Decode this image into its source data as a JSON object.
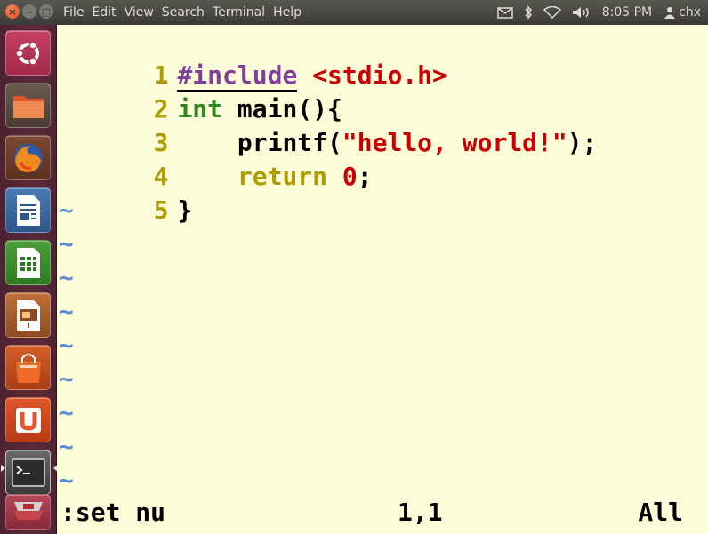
{
  "window": {
    "menu": [
      "File",
      "Edit",
      "View",
      "Search",
      "Terminal",
      "Help"
    ]
  },
  "panel": {
    "clock": "8:05 PM",
    "user": "chx",
    "indicators": [
      "mail-icon",
      "bluetooth-icon",
      "wifi-icon",
      "volume-icon"
    ]
  },
  "launcher": {
    "items": [
      "ubuntu-dash",
      "files",
      "firefox",
      "libreoffice-writer",
      "libreoffice-calc",
      "libreoffice-impress",
      "ubuntu-software-center",
      "ubuntu-one",
      "terminal",
      "trash-stack"
    ]
  },
  "editor": {
    "line_numbers": [
      "1",
      "2",
      "3",
      "4",
      "5"
    ],
    "lines": [
      {
        "preproc": "#include",
        "include_path": "<stdio.h>"
      },
      {
        "type_kw": "int",
        "rest": "main(){"
      },
      {
        "indent": "    ",
        "fn": "printf(",
        "string": "\"hello, world!\"",
        "tail": ");"
      },
      {
        "indent": "    ",
        "keyword": "return",
        "number": "0",
        "tail": ";"
      },
      {
        "rest": "}"
      }
    ],
    "tilde": "~",
    "empty_lines": 9
  },
  "status": {
    "command": ":set nu",
    "position": "1,1",
    "scroll": "All"
  },
  "colors": {
    "background": "#fefdd9",
    "line_number": "#af9c00",
    "preproc": "#7f3f9a",
    "string": "#cc0000",
    "type": "#2e8a20",
    "tilde": "#5b8ad6"
  }
}
